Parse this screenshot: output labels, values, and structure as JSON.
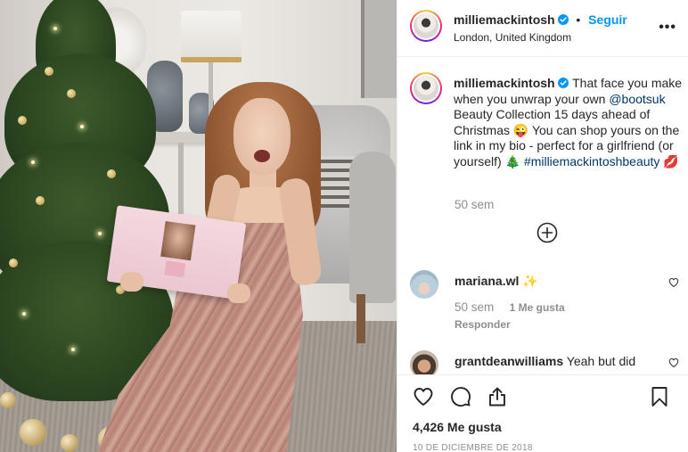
{
  "post": {
    "username": "milliemackintosh",
    "follow_label": "Seguir",
    "location": "London, United Kingdom",
    "separator": "•",
    "more_label": "•••"
  },
  "caption": {
    "username": "milliemackintosh",
    "text_1": "That face you make when you unwrap your own ",
    "mention": "@bootsuk",
    "text_2": " Beauty Collection 15 days ahead of Christmas 😜 You can shop yours on the link in my bio - perfect for a girlfriend (or yourself) 🎄 ",
    "hashtag": "#milliemackintoshbeauty",
    "emoji_end": " 💋",
    "time": "50 sem"
  },
  "comments": [
    {
      "username": "mariana.wl",
      "text": "✨",
      "time": "50 sem",
      "likes": "1 Me gusta",
      "reply": "Responder"
    },
    {
      "username": "grantdeanwilliams",
      "text": "Yeah but did"
    }
  ],
  "actions": {
    "likes": "4,426 Me gusta",
    "date": "10 DE DICIEMBRE DE 2018"
  },
  "colors": {
    "link_blue": "#0095f6",
    "mention_blue": "#00376b",
    "verified_blue": "#0095f6",
    "muted": "#8e8e8e"
  }
}
